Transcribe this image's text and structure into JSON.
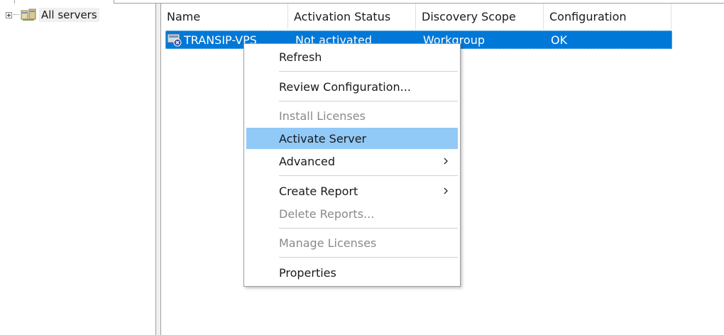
{
  "tree": {
    "root_label": "All servers"
  },
  "list": {
    "columns": [
      "Name",
      "Activation Status",
      "Discovery Scope",
      "Configuration"
    ],
    "rows": [
      {
        "name": "TRANSIP-VPS",
        "activation_status": "Not activated",
        "discovery_scope": "Workgroup",
        "configuration": "OK"
      }
    ]
  },
  "context_menu": {
    "items": [
      {
        "label": "Refresh",
        "enabled": true
      },
      {
        "label": "Review Configuration...",
        "enabled": true
      },
      {
        "label": "Install Licenses",
        "enabled": false
      },
      {
        "label": "Activate Server",
        "enabled": true,
        "highlighted": true
      },
      {
        "label": "Advanced",
        "enabled": true,
        "submenu": true
      },
      {
        "label": "Create Report",
        "enabled": true,
        "submenu": true
      },
      {
        "label": "Delete Reports...",
        "enabled": false
      },
      {
        "label": "Manage Licenses",
        "enabled": false
      },
      {
        "label": "Properties",
        "enabled": true
      }
    ]
  },
  "colors": {
    "selection": "#0078d7",
    "menu_highlight": "#91c9f7",
    "disabled_text": "#8a8a8a"
  },
  "icons": {
    "tree_root": "server-group-icon",
    "row": "server-not-activated-icon",
    "submenu": "chevron-right-icon"
  }
}
